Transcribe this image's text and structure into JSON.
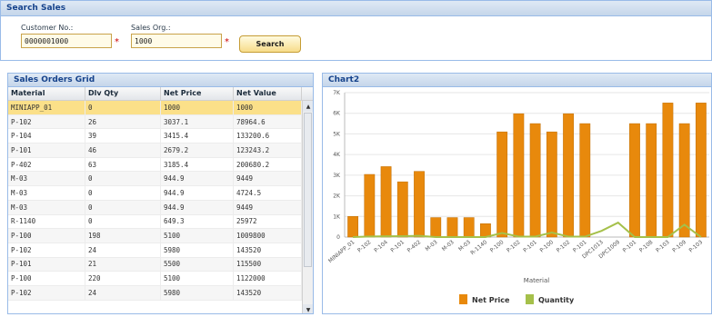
{
  "search": {
    "title": "Search Sales",
    "customer_label": "Customer No.:",
    "customer_value": "0000001000",
    "salesorg_label": "Sales Org.:",
    "salesorg_value": "1000",
    "required_mark": "*",
    "search_button": "Search"
  },
  "grid": {
    "title": "Sales Orders Grid",
    "columns": [
      "Material",
      "Dlv Qty",
      "Net Price",
      "Net Value"
    ],
    "rows": [
      [
        "MINIAPP_01",
        "0",
        "1000",
        "1000"
      ],
      [
        "P-102",
        "26",
        "3037.1",
        "78964.6"
      ],
      [
        "P-104",
        "39",
        "3415.4",
        "133200.6"
      ],
      [
        "P-101",
        "46",
        "2679.2",
        "123243.2"
      ],
      [
        "P-402",
        "63",
        "3185.4",
        "200680.2"
      ],
      [
        "M-03",
        "0",
        "944.9",
        "9449"
      ],
      [
        "M-03",
        "0",
        "944.9",
        "4724.5"
      ],
      [
        "M-03",
        "0",
        "944.9",
        "9449"
      ],
      [
        "R-1140",
        "0",
        "649.3",
        "25972"
      ],
      [
        "P-100",
        "198",
        "5100",
        "1009800"
      ],
      [
        "P-102",
        "24",
        "5980",
        "143520"
      ],
      [
        "P-101",
        "21",
        "5500",
        "115500"
      ],
      [
        "P-100",
        "220",
        "5100",
        "1122000"
      ],
      [
        "P-102",
        "24",
        "5980",
        "143520"
      ]
    ],
    "selected_row": 0,
    "scroll_up": "▲",
    "scroll_down": "▼"
  },
  "chart": {
    "title": "Chart2",
    "bar_color": "#e8890c",
    "line_color": "#a5c04a"
  },
  "chart_data": {
    "type": "bar",
    "title": "",
    "xlabel": "Material",
    "ylabel": "",
    "ylim": [
      0,
      7000
    ],
    "y_ticks": [
      "0",
      "1K",
      "2K",
      "3K",
      "4K",
      "5K",
      "6K",
      "7K"
    ],
    "categories": [
      "MINIAPP_01",
      "P-102",
      "P-104",
      "P-101",
      "P-402",
      "M-03",
      "M-03",
      "M-03",
      "R-1140",
      "P-100",
      "P-102",
      "P-101",
      "P-100",
      "P-102",
      "P-101",
      "DPC1013",
      "DPC1009",
      "P-101",
      "P-108",
      "P-103",
      "P-109",
      "P-103"
    ],
    "series": [
      {
        "name": "Net Price",
        "type": "bar",
        "values": [
          1000,
          3037.1,
          3415.4,
          2679.2,
          3185.4,
          944.9,
          944.9,
          944.9,
          649.3,
          5100,
          5980,
          5500,
          5100,
          5980,
          5500,
          0,
          0,
          5500,
          5500,
          6500,
          5500,
          6500
        ]
      },
      {
        "name": "Quantity",
        "type": "line",
        "values": [
          0,
          26,
          39,
          46,
          63,
          0,
          0,
          0,
          0,
          198,
          24,
          21,
          220,
          24,
          21,
          300,
          700,
          0,
          0,
          0,
          600,
          0
        ]
      }
    ],
    "grid": true,
    "legend": "bottom"
  }
}
